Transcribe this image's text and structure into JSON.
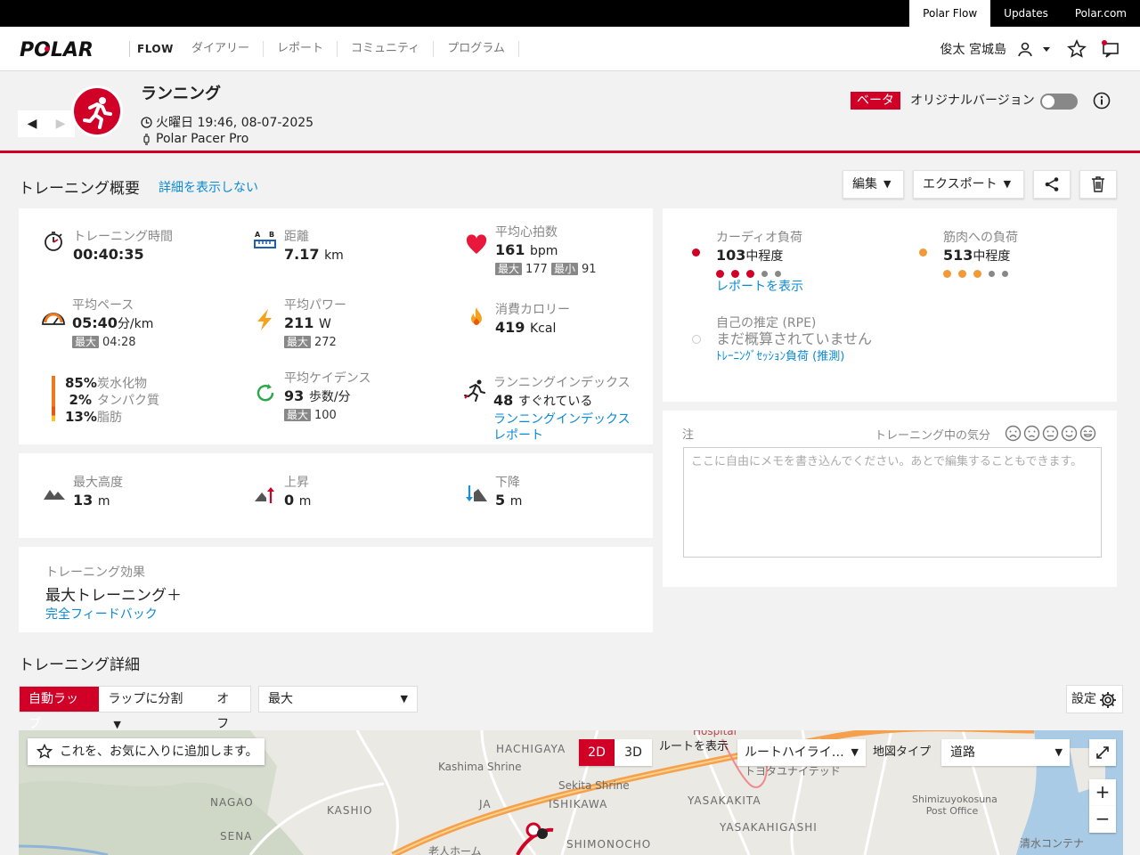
{
  "topbar": {
    "links": [
      "Polar Flow",
      "Updates",
      "Polar.com"
    ]
  },
  "nav": {
    "brand": "POLAR",
    "flow": "FLOW",
    "menu": [
      "ダイアリー",
      "レポート",
      "コミュニティ",
      "プログラム"
    ],
    "user": "俊太 宮城島"
  },
  "activity": {
    "title": "ランニング",
    "datetime": "火曜日 19:46, 08-07-2025",
    "device": "Polar Pacer Pro",
    "beta": "ベータ",
    "original_version": "オリジナルバージョン"
  },
  "summary": {
    "title": "トレーニング概要",
    "hide_details": "詳細を表示しない",
    "edit": "編集",
    "export": "エクスポート",
    "duration": {
      "label": "トレーニング時間",
      "value": "00:40:35"
    },
    "distance": {
      "label": "距離",
      "value": "7.17",
      "unit": "km"
    },
    "heart_rate": {
      "label": "平均心拍数",
      "value": "161",
      "unit": "bpm",
      "max_label": "最大",
      "max": "177",
      "min_label": "最小",
      "min": "91"
    },
    "pace": {
      "label": "平均ペース",
      "value": "05:40",
      "unit": "分/km",
      "max_label": "最大",
      "max": "04:28"
    },
    "power": {
      "label": "平均パワー",
      "value": "211",
      "unit": "W",
      "max_label": "最大",
      "max": "272"
    },
    "calories": {
      "label": "消費カロリー",
      "value": "419",
      "unit": "Kcal"
    },
    "carb": {
      "pct": "85%",
      "label": "炭水化物"
    },
    "protein": {
      "pct": "2%",
      "label": "タンパク質"
    },
    "fat": {
      "pct": "13%",
      "label": "脂肪"
    },
    "cadence": {
      "label": "平均ケイデンス",
      "value": "93",
      "unit": "歩数/分",
      "max_label": "最大",
      "max": "100"
    },
    "running_index": {
      "label": "ランニングインデックス",
      "value": "48",
      "desc": "すぐれている",
      "link": "ランニングインデックスレポート"
    },
    "max_alt": {
      "label": "最大高度",
      "value": "13",
      "unit": "m"
    },
    "ascent": {
      "label": "上昇",
      "value": "0",
      "unit": "m"
    },
    "descent": {
      "label": "下降",
      "value": "5",
      "unit": "m"
    },
    "effect": {
      "label": "トレーニング効果",
      "value": "最大トレーニング＋",
      "link": "完全フィードバック"
    }
  },
  "load": {
    "cardio": {
      "label": "カーディオ負荷",
      "value": "103",
      "desc": "中程度",
      "link": "レポートを表示",
      "color": "#d10027",
      "level": 3,
      "max_level": 5
    },
    "muscle": {
      "label": "筋肉への負荷",
      "value": "513",
      "desc": "中程度",
      "color": "#f29a38",
      "level": 3,
      "max_level": 5
    },
    "rpe": {
      "label": "自己の推定 (RPE)",
      "value": "まだ概算されていません",
      "link": "ﾄﾚｰﾆﾝｸﾞｾｯｼｮﾝ負荷 (推測)"
    }
  },
  "notes": {
    "label": "注",
    "mood": "トレーニング中の気分",
    "placeholder": "ここに自由にメモを書き込んでください。あとで編集することもできます。"
  },
  "details": {
    "title": "トレーニング詳細",
    "laps": [
      "自動ラップ",
      "ラップに分割",
      "オフ"
    ],
    "zoom_select": "最大",
    "settings": "設定"
  },
  "map": {
    "favorite": "これを、お気に入りに追加します。",
    "mode_2d": "2D",
    "mode_3d": "3D",
    "route_show": "ルートを表示",
    "route_highlight": "ルートハイライ…",
    "map_type_label": "地図タイプ",
    "map_type": "道路",
    "labels": [
      "HACHIGAYA",
      "Kashima Shrine",
      "Sekita Shrine",
      "ISHIKAWA",
      "NAGAO",
      "KASHIO",
      "SENA",
      "JA",
      "YASAKAKITA",
      "YASAKAHIGASHI",
      "SHIMONOCHO",
      "Shimizuyokosuna Post Office",
      "トヨタユナイテッド",
      "Hospital",
      "老人ホーム",
      "清水コンテナ"
    ]
  }
}
